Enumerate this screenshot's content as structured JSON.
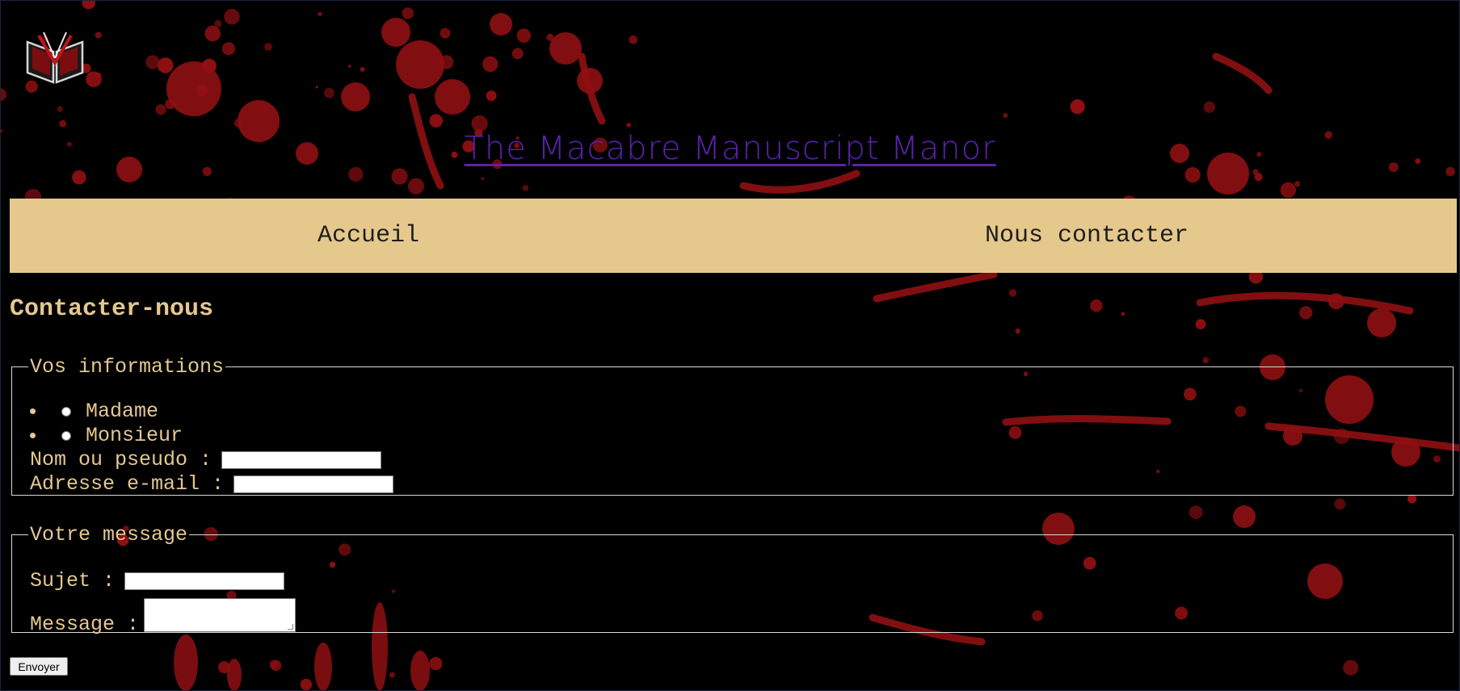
{
  "colors": {
    "background": "#000000",
    "accent_text": "#e5c890",
    "nav_background": "#e5c88c",
    "title_link": "#5a22a8",
    "blood": "#8f0f12"
  },
  "logo": {
    "icon": "open-book-blood-logo"
  },
  "site": {
    "title": "The Macabre Manuscript Manor"
  },
  "nav": {
    "items": [
      "Accueil",
      "Nous contacter"
    ]
  },
  "page": {
    "heading": "Contacter-nous"
  },
  "form": {
    "info_legend": "Vos informations",
    "civility_options": [
      "Madame",
      "Monsieur"
    ],
    "name_label": "Nom ou pseudo :",
    "name_value": "",
    "email_label": "Adresse e-mail :",
    "email_value": "",
    "message_legend": "Votre message",
    "subject_label": "Sujet :",
    "subject_value": "",
    "message_label": "Message :",
    "message_value": "",
    "submit_label": "Envoyer"
  }
}
